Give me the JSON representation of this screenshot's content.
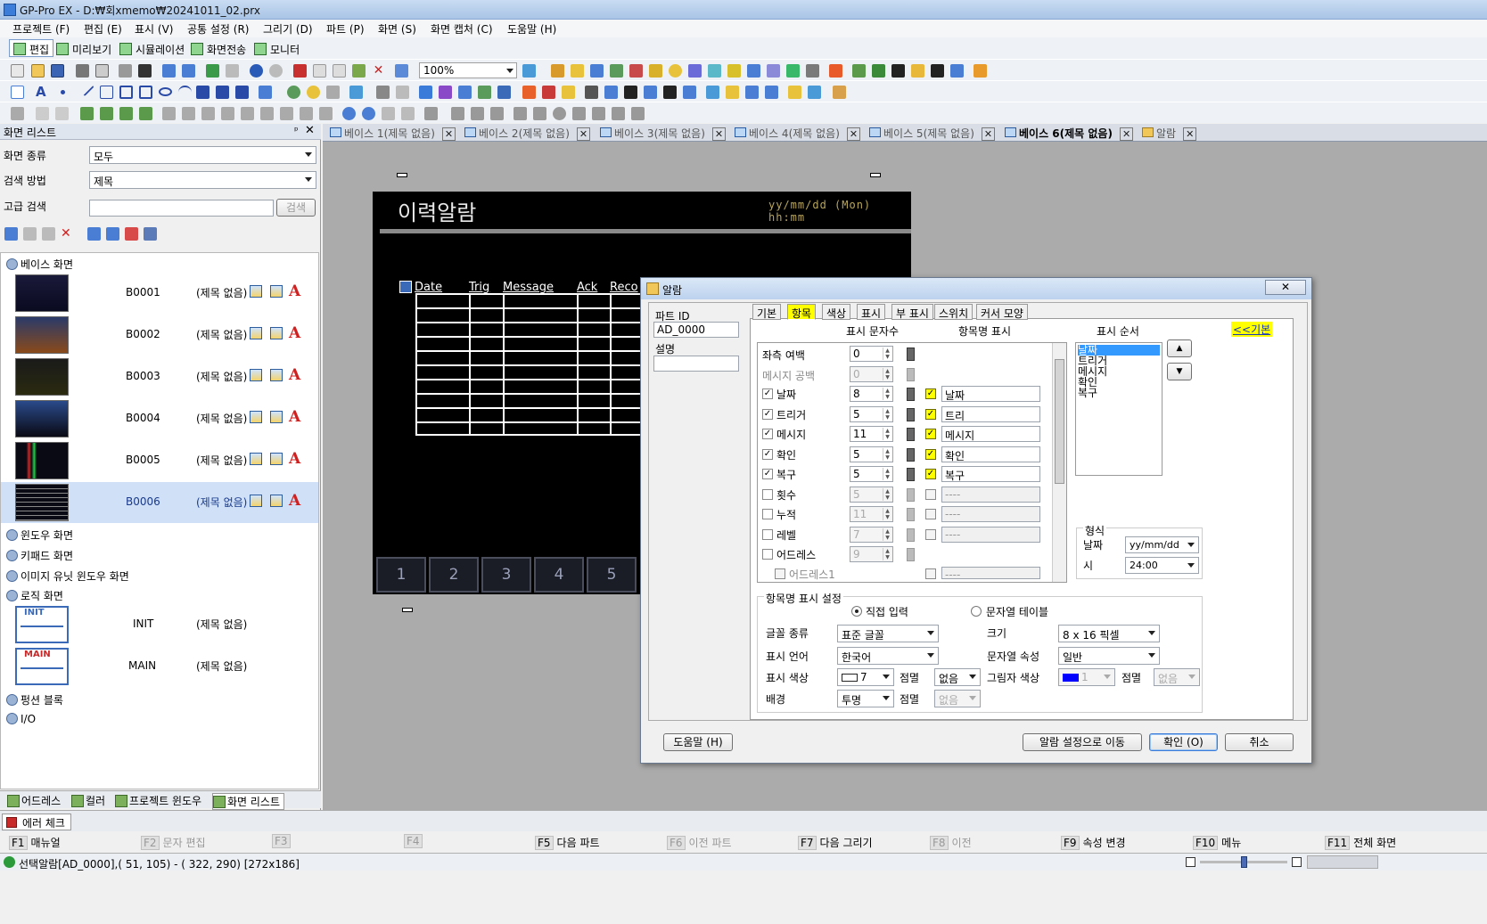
{
  "title_bar": {
    "title": "GP-Pro EX - D:₩회xmemo₩20241011_02.prx"
  },
  "menu": [
    "프로젝트 (F)",
    "편집 (E)",
    "표시 (V)",
    "공통 설정 (R)",
    "그리기 (D)",
    "파트 (P)",
    "화면 (S)",
    "화면 캡처 (C)",
    "도움말 (H)"
  ],
  "modes": [
    "편집",
    "미리보기",
    "시뮬레이션",
    "화면전송",
    "모니터"
  ],
  "toolbar": {
    "zoom": "100%"
  },
  "left_panel": {
    "title": "화면 리스트",
    "screen_type_label": "화면 종류",
    "screen_type_value": "모두",
    "search_method_label": "검색 방법",
    "search_method_value": "제목",
    "advanced_label": "고급 검색",
    "search_button": "검색",
    "tree": {
      "base_label": "베이스 화면",
      "screens": [
        {
          "id": "B0001",
          "title": "(제목 없음)"
        },
        {
          "id": "B0002",
          "title": "(제목 없음)"
        },
        {
          "id": "B0003",
          "title": "(제목 없음)"
        },
        {
          "id": "B0004",
          "title": "(제목 없음)"
        },
        {
          "id": "B0005",
          "title": "(제목 없음)"
        },
        {
          "id": "B0006",
          "title": "(제목 없음)"
        }
      ],
      "window_label": "윈도우 화면",
      "keypad_label": "키패드 화면",
      "image_unit_label": "이미지 유닛 윈도우 화면",
      "logic_label": "로직 화면",
      "logic": [
        {
          "id": "INIT",
          "title": "(제목 없음)"
        },
        {
          "id": "MAIN",
          "title": "(제목 없음)"
        }
      ],
      "function_label": "펑션 블록",
      "io_label": "I/O"
    },
    "tabs": [
      "어드레스",
      "컬러",
      "프로젝트 윈도우",
      "화면 리스트"
    ]
  },
  "doc_tabs": [
    "베이스 1(제목 없음)",
    "베이스 2(제목 없음)",
    "베이스 3(제목 없음)",
    "베이스 4(제목 없음)",
    "베이스 5(제목 없음)",
    "베이스 6(제목 없음)",
    "알람"
  ],
  "canvas": {
    "title": "이력알람",
    "datetime": "yy/mm/dd (Mon) hh:mm",
    "headers": [
      "Date",
      "Trig",
      "Message",
      "Ack",
      "Reco"
    ],
    "buttons": [
      "1",
      "2",
      "3",
      "4",
      "5"
    ]
  },
  "dialog": {
    "title": "알람",
    "part_id_label": "파트 ID",
    "part_id": "AD_0000",
    "desc_label": "설명",
    "tabs": [
      "기본",
      "항목",
      "색상",
      "표시",
      "부 표시",
      "스위치",
      "커서 모양"
    ],
    "col_chars": "표시 문자수",
    "col_names": "항목명 표시",
    "col_order": "표시 순서",
    "basic_link": "<<기본",
    "rows": [
      {
        "label": "좌측 여백",
        "chars": "0",
        "checked": null,
        "name_checked": null,
        "name": ""
      },
      {
        "label": "메시지 공백",
        "chars": "0",
        "checked": null,
        "name_checked": null,
        "name": "",
        "disabled": true
      },
      {
        "label": "날짜",
        "chars": "8",
        "checked": true,
        "name_checked": true,
        "name": "날짜"
      },
      {
        "label": "트리거",
        "chars": "5",
        "checked": true,
        "name_checked": true,
        "name": "트리"
      },
      {
        "label": "메시지",
        "chars": "11",
        "checked": true,
        "name_checked": true,
        "name": "메시지"
      },
      {
        "label": "확인",
        "chars": "5",
        "checked": true,
        "name_checked": true,
        "name": "확인"
      },
      {
        "label": "복구",
        "chars": "5",
        "checked": true,
        "name_checked": true,
        "name": "복구"
      },
      {
        "label": "횟수",
        "chars": "5",
        "checked": false,
        "name_checked": false,
        "name": "----",
        "disabled": true
      },
      {
        "label": "누적",
        "chars": "11",
        "checked": false,
        "name_checked": false,
        "name": "----",
        "disabled": true
      },
      {
        "label": "레벨",
        "chars": "7",
        "checked": false,
        "name_checked": false,
        "name": "----",
        "disabled": true
      },
      {
        "label": "어드레스",
        "chars": "9",
        "checked": false,
        "name_checked": null,
        "name": "",
        "disabled": true
      },
      {
        "label": "어드레스1",
        "chars": "",
        "checked": false,
        "name_checked": false,
        "name": "----",
        "disabled": true
      }
    ],
    "order": [
      "날짜",
      "트리거",
      "메시지",
      "확인",
      "복구"
    ],
    "format_label": "형식",
    "date_label": "날짜",
    "date_value": "yy/mm/dd",
    "time_label": "시",
    "time_value": "24:00",
    "name_settings_label": "항목명 표시 설정",
    "radio_direct": "직접 입력",
    "radio_table": "문자열 테이블",
    "font_label": "글꼴 종류",
    "font_value": "표준 글꼴",
    "size_label": "크기",
    "size_value": "8 x 16 픽셀",
    "lang_label": "표시 언어",
    "lang_value": "한국어",
    "attr_label": "문자열 속성",
    "attr_value": "일반",
    "color_label": "표시 색상",
    "color_value": "7",
    "blink_label": "점멸",
    "blink_value": "없음",
    "shadow_label": "그림자 색상",
    "shadow_value": "1",
    "shadow_blink_value": "없음",
    "bg_label": "배경",
    "bg_value": "투명",
    "bg_blink_value": "없음",
    "help_button": "도움말 (H)",
    "goto_button": "알람 설정으로 이동",
    "ok_button": "확인 (O)",
    "cancel_button": "취소",
    "accent": "#ffff00"
  },
  "error_tab": "에러 체크",
  "fkeys": [
    {
      "k": "F1",
      "t": "매뉴얼",
      "dis": false
    },
    {
      "k": "F2",
      "t": "문자 편집",
      "dis": true
    },
    {
      "k": "F3",
      "t": "",
      "dis": true
    },
    {
      "k": "F4",
      "t": "",
      "dis": true
    },
    {
      "k": "F5",
      "t": "다음 파트",
      "dis": false
    },
    {
      "k": "F6",
      "t": "이전 파트",
      "dis": true
    },
    {
      "k": "F7",
      "t": "다음 그리기",
      "dis": false
    },
    {
      "k": "F8",
      "t": "이전",
      "dis": true
    },
    {
      "k": "F9",
      "t": "속성 변경",
      "dis": false
    },
    {
      "k": "F10",
      "t": "메뉴",
      "dis": false
    },
    {
      "k": "F11",
      "t": "전체 화면",
      "dis": false
    }
  ],
  "status": "선택알람[AD_0000],( 51, 105) - ( 322, 290) [272x186]"
}
